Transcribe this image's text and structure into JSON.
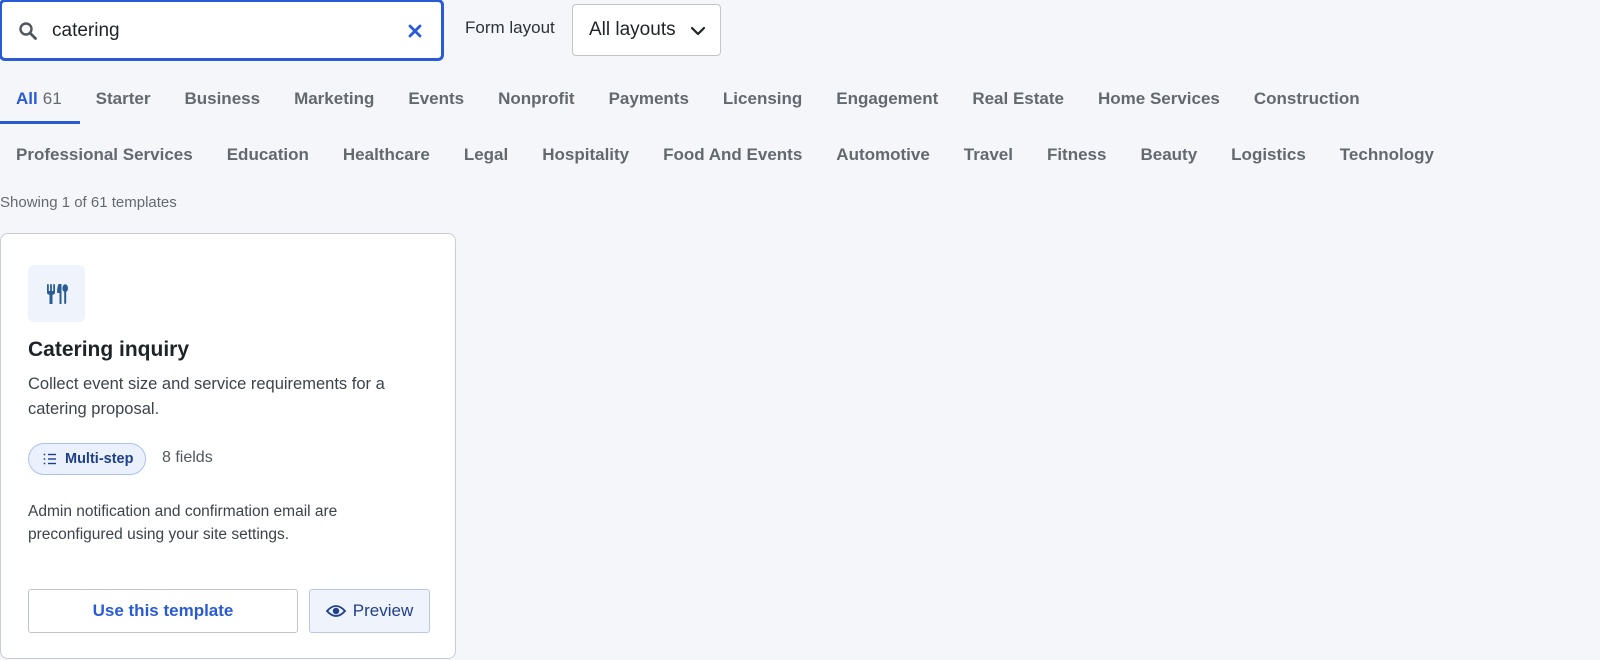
{
  "search": {
    "value": "catering",
    "icon": "search-icon",
    "clear_icon": "close-icon"
  },
  "layout_filter": {
    "label": "Form layout",
    "selected": "All layouts",
    "icon": "chevron-down-icon"
  },
  "tabs_row1": [
    {
      "label": "All",
      "count": "61",
      "active": true
    },
    {
      "label": "Starter"
    },
    {
      "label": "Business"
    },
    {
      "label": "Marketing"
    },
    {
      "label": "Events"
    },
    {
      "label": "Nonprofit"
    },
    {
      "label": "Payments"
    },
    {
      "label": "Licensing"
    },
    {
      "label": "Engagement"
    },
    {
      "label": "Real Estate"
    },
    {
      "label": "Home Services"
    },
    {
      "label": "Construction"
    }
  ],
  "tabs_row2": [
    {
      "label": "Professional Services"
    },
    {
      "label": "Education"
    },
    {
      "label": "Healthcare"
    },
    {
      "label": "Legal"
    },
    {
      "label": "Hospitality"
    },
    {
      "label": "Food And Events"
    },
    {
      "label": "Automotive"
    },
    {
      "label": "Travel"
    },
    {
      "label": "Fitness"
    },
    {
      "label": "Beauty"
    },
    {
      "label": "Logistics"
    },
    {
      "label": "Technology"
    }
  ],
  "results": {
    "showing": "Showing 1 of 61 templates"
  },
  "card": {
    "icon": "utensils-icon",
    "title": "Catering inquiry",
    "description": "Collect event size and service requirements for a catering proposal.",
    "badge": "Multi-step",
    "badge_icon": "list-icon",
    "fields": "8 fields",
    "note": "Admin notification and confirmation email are preconfigured using your site settings.",
    "use_button": "Use this template",
    "preview_button": "Preview",
    "preview_icon": "eye-icon"
  },
  "colors": {
    "accent": "#2a5bd7",
    "background": "#f5f6fa",
    "badge_bg": "#eaf1fd",
    "icon_bg": "#eef3fc"
  }
}
